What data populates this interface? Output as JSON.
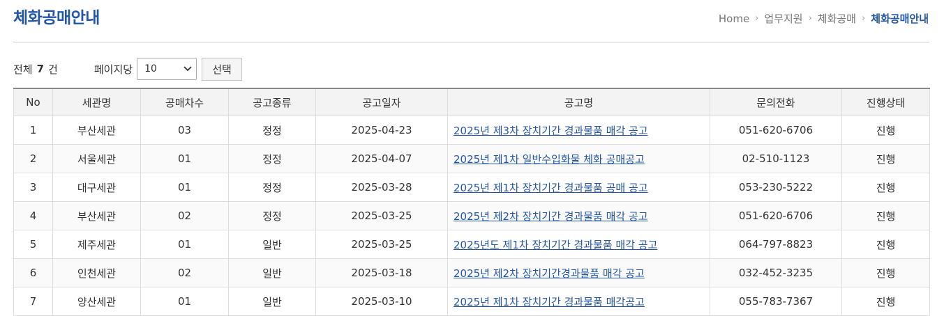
{
  "page": {
    "title": "체화공매안내"
  },
  "breadcrumb": [
    "Home",
    "업무지원",
    "체화공매",
    "체화공매안내"
  ],
  "toolbar": {
    "total_prefix": "전체",
    "total_count": "7",
    "total_suffix": "건",
    "per_page_label": "페이지당",
    "per_page_value": "10",
    "select_button": "선택"
  },
  "table": {
    "headers": [
      "No",
      "세관명",
      "공매차수",
      "공고종류",
      "공고일자",
      "공고명",
      "문의전화",
      "진행상태"
    ],
    "rows": [
      {
        "no": "1",
        "office": "부산세관",
        "round": "03",
        "type": "정정",
        "date": "2025-04-23",
        "title": "2025년 제3차 장치기간 경과물품 매각 공고",
        "phone": "051-620-6706",
        "status": "진행"
      },
      {
        "no": "2",
        "office": "서울세관",
        "round": "01",
        "type": "정정",
        "date": "2025-04-07",
        "title": "2025년 제1차 일반수입화물 체화 공매공고",
        "phone": "02-510-1123",
        "status": "진행"
      },
      {
        "no": "3",
        "office": "대구세관",
        "round": "01",
        "type": "정정",
        "date": "2025-03-28",
        "title": "2025년 제1차 장치기간 경과물품 공매 공고",
        "phone": "053-230-5222",
        "status": "진행"
      },
      {
        "no": "4",
        "office": "부산세관",
        "round": "02",
        "type": "정정",
        "date": "2025-03-25",
        "title": "2025년 제2차 장치기간 경과물품 매각 공고",
        "phone": "051-620-6706",
        "status": "진행"
      },
      {
        "no": "5",
        "office": "제주세관",
        "round": "01",
        "type": "일반",
        "date": "2025-03-25",
        "title": "2025년도 제1차 장치기간 경과물품 매각 공고",
        "phone": "064-797-8823",
        "status": "진행"
      },
      {
        "no": "6",
        "office": "인천세관",
        "round": "02",
        "type": "일반",
        "date": "2025-03-18",
        "title": "2025년 제2차 장치기간경과물품 매각 공고",
        "phone": "032-452-3235",
        "status": "진행"
      },
      {
        "no": "7",
        "office": "양산세관",
        "round": "01",
        "type": "일반",
        "date": "2025-03-10",
        "title": "2025년 제1차 장치기간 경과물품 매각공고",
        "phone": "055-783-7367",
        "status": "진행"
      }
    ]
  },
  "colors": {
    "accent": "#2456a6",
    "header_bg": "#f3f3f3",
    "border": "#dddddd"
  }
}
